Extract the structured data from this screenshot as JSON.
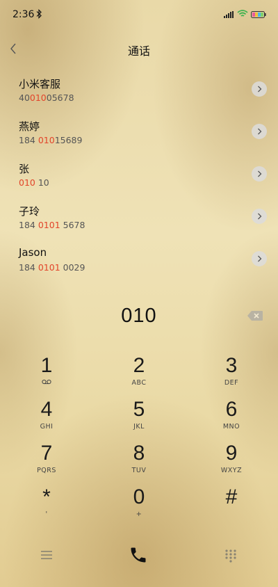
{
  "status_bar": {
    "time": "2:36",
    "icons": [
      "bluetooth-icon",
      "signal-icon",
      "wifi-icon",
      "battery-icon"
    ]
  },
  "header": {
    "title": "通话",
    "back_icon": "chevron-left-icon"
  },
  "contacts": [
    {
      "name": "小米客服",
      "number_pre": "40",
      "number_match": "010",
      "number_post": "05678"
    },
    {
      "name": "燕婷",
      "number_pre": "184 ",
      "number_match": "010",
      "number_post": "15689"
    },
    {
      "name": "张",
      "number_pre": "",
      "number_match": "010",
      "number_post": " 10"
    },
    {
      "name": "子玲",
      "number_pre": "184 ",
      "number_match": "0101",
      "number_post": " 5678"
    },
    {
      "name": "Jason",
      "number_pre": "184 ",
      "number_match": "0101",
      "number_post": " 0029"
    }
  ],
  "dialer": {
    "input_value": "010",
    "delete_icon": "backspace-icon"
  },
  "keypad": [
    {
      "digit": "1",
      "letters": "",
      "sub_icon": "voicemail-icon"
    },
    {
      "digit": "2",
      "letters": "ABC"
    },
    {
      "digit": "3",
      "letters": "DEF"
    },
    {
      "digit": "4",
      "letters": "GHI"
    },
    {
      "digit": "5",
      "letters": "JKL"
    },
    {
      "digit": "6",
      "letters": "MNO"
    },
    {
      "digit": "7",
      "letters": "PQRS"
    },
    {
      "digit": "8",
      "letters": "TUV"
    },
    {
      "digit": "9",
      "letters": "WXYZ"
    },
    {
      "digit": "*",
      "letters": "'"
    },
    {
      "digit": "0",
      "letters": "+"
    },
    {
      "digit": "#",
      "letters": ""
    }
  ],
  "colors": {
    "match_highlight": "#e2442a",
    "text_primary": "#111111"
  },
  "bottom_bar": {
    "icons": [
      "menu-icon",
      "phone-icon",
      "keypad-grid-icon"
    ]
  }
}
